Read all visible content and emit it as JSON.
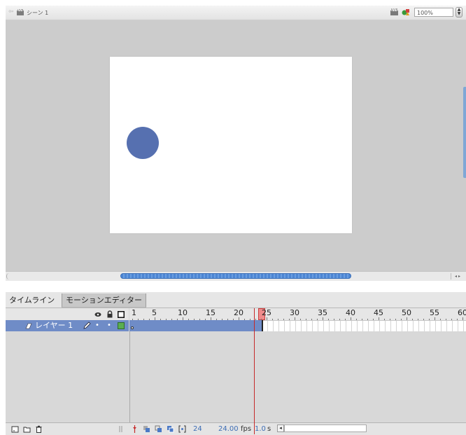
{
  "stage": {
    "scene_label": "シーン 1",
    "zoom_value": "100%",
    "object_color": "#5670b0"
  },
  "timeline": {
    "tabs": [
      {
        "label": "タイムライン",
        "active": true
      },
      {
        "label": "モーションエディター",
        "active": false
      }
    ],
    "ruler": {
      "first_label": "1",
      "labels": [
        "5",
        "10",
        "15",
        "20",
        "25",
        "30",
        "35",
        "40",
        "45",
        "50",
        "55",
        "60"
      ],
      "current_frame": 24
    },
    "layers": [
      {
        "name": "レイヤー 1",
        "selected": true,
        "outline_color": "#5aae50"
      }
    ],
    "status": {
      "current_frame": "24",
      "frame_rate": "24.00",
      "frame_rate_unit": "fps",
      "elapsed_time": "1.0",
      "elapsed_unit": "s"
    }
  },
  "icons": [
    "scene-icon",
    "edit-scene-icon",
    "edit-symbol-icon",
    "eye-icon",
    "lock-icon",
    "outline-icon",
    "layer-icon",
    "pencil-icon",
    "new-layer-icon",
    "new-folder-icon",
    "trash-icon",
    "onion-skin-icon"
  ]
}
